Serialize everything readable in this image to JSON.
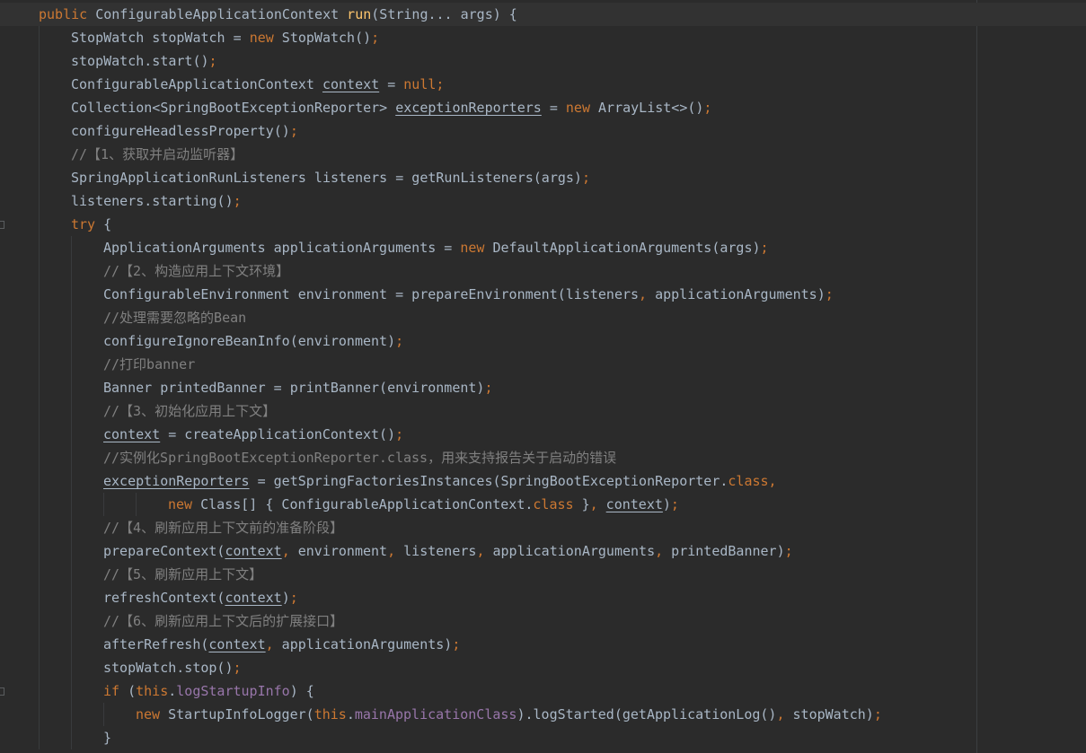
{
  "editor": {
    "language": "Java",
    "colors": {
      "background": "#2b2b2b",
      "keyword": "#cc7832",
      "method_declaration": "#ffc66d",
      "comment": "#808080",
      "field": "#9876aa",
      "plain": "#a9b7c6",
      "current_line": "#323232"
    },
    "lines": [
      {
        "indent": 0,
        "current": true,
        "tokens": [
          {
            "t": "public",
            "c": "kw"
          },
          {
            "t": " ConfigurableApplicationContext ",
            "c": "pl"
          },
          {
            "t": "run",
            "c": "fn"
          },
          {
            "t": "(String... args) {",
            "c": "pl"
          }
        ]
      },
      {
        "indent": 1,
        "tokens": [
          {
            "t": "StopWatch stopWatch = ",
            "c": "pl"
          },
          {
            "t": "new",
            "c": "kw"
          },
          {
            "t": " StopWatch()",
            "c": "pl"
          },
          {
            "t": ";",
            "c": "kw"
          }
        ]
      },
      {
        "indent": 1,
        "tokens": [
          {
            "t": "stopWatch.start()",
            "c": "pl"
          },
          {
            "t": ";",
            "c": "kw"
          }
        ]
      },
      {
        "indent": 1,
        "tokens": [
          {
            "t": "ConfigurableApplicationContext ",
            "c": "pl"
          },
          {
            "t": "context",
            "c": "pl",
            "u": true
          },
          {
            "t": " = ",
            "c": "pl"
          },
          {
            "t": "null;",
            "c": "kw"
          }
        ]
      },
      {
        "indent": 1,
        "tokens": [
          {
            "t": "Collection<SpringBootExceptionReporter> ",
            "c": "pl"
          },
          {
            "t": "exceptionReporters",
            "c": "pl",
            "u": true
          },
          {
            "t": " = ",
            "c": "pl"
          },
          {
            "t": "new",
            "c": "kw"
          },
          {
            "t": " ArrayList<>()",
            "c": "pl"
          },
          {
            "t": ";",
            "c": "kw"
          }
        ]
      },
      {
        "indent": 1,
        "tokens": [
          {
            "t": "configureHeadlessProperty()",
            "c": "pl"
          },
          {
            "t": ";",
            "c": "kw"
          }
        ]
      },
      {
        "indent": 1,
        "tokens": [
          {
            "t": "//【1、获取并启动监听器】",
            "c": "cm"
          }
        ]
      },
      {
        "indent": 1,
        "tokens": [
          {
            "t": "SpringApplicationRunListeners listeners = getRunListeners(args)",
            "c": "pl"
          },
          {
            "t": ";",
            "c": "kw"
          }
        ]
      },
      {
        "indent": 1,
        "tokens": [
          {
            "t": "listeners.starting()",
            "c": "pl"
          },
          {
            "t": ";",
            "c": "kw"
          }
        ]
      },
      {
        "indent": 1,
        "tokens": [
          {
            "t": "try",
            "c": "kw"
          },
          {
            "t": " {",
            "c": "pl"
          }
        ]
      },
      {
        "indent": 2,
        "tokens": [
          {
            "t": "ApplicationArguments applicationArguments = ",
            "c": "pl"
          },
          {
            "t": "new",
            "c": "kw"
          },
          {
            "t": " DefaultApplicationArguments(args)",
            "c": "pl"
          },
          {
            "t": ";",
            "c": "kw"
          }
        ]
      },
      {
        "indent": 2,
        "tokens": [
          {
            "t": "//【2、构造应用上下文环境】",
            "c": "cm"
          }
        ]
      },
      {
        "indent": 2,
        "tokens": [
          {
            "t": "ConfigurableEnvironment environment = prepareEnvironment(listeners",
            "c": "pl"
          },
          {
            "t": ",",
            "c": "kw"
          },
          {
            "t": " applicationArguments)",
            "c": "pl"
          },
          {
            "t": ";",
            "c": "kw"
          }
        ]
      },
      {
        "indent": 2,
        "tokens": [
          {
            "t": "//处理需要忽略的Bean",
            "c": "cm"
          }
        ]
      },
      {
        "indent": 2,
        "tokens": [
          {
            "t": "configureIgnoreBeanInfo(environment)",
            "c": "pl"
          },
          {
            "t": ";",
            "c": "kw"
          }
        ]
      },
      {
        "indent": 2,
        "tokens": [
          {
            "t": "//打印banner",
            "c": "cm"
          }
        ]
      },
      {
        "indent": 2,
        "tokens": [
          {
            "t": "Banner printedBanner = printBanner(environment)",
            "c": "pl"
          },
          {
            "t": ";",
            "c": "kw"
          }
        ]
      },
      {
        "indent": 2,
        "tokens": [
          {
            "t": "//【3、初始化应用上下文】",
            "c": "cm"
          }
        ]
      },
      {
        "indent": 2,
        "tokens": [
          {
            "t": "context",
            "c": "pl",
            "u": true
          },
          {
            "t": " = createApplicationContext()",
            "c": "pl"
          },
          {
            "t": ";",
            "c": "kw"
          }
        ]
      },
      {
        "indent": 2,
        "tokens": [
          {
            "t": "//实例化SpringBootExceptionReporter.class，用来支持报告关于启动的错误",
            "c": "cm"
          }
        ]
      },
      {
        "indent": 2,
        "tokens": [
          {
            "t": "exceptionReporters",
            "c": "pl",
            "u": true
          },
          {
            "t": " = getSpringFactoriesInstances(SpringBootExceptionReporter.",
            "c": "pl"
          },
          {
            "t": "class,",
            "c": "kw"
          }
        ]
      },
      {
        "indent": 4,
        "tokens": [
          {
            "t": "new",
            "c": "kw"
          },
          {
            "t": " Class[] { ConfigurableApplicationContext.",
            "c": "pl"
          },
          {
            "t": "class",
            "c": "kw"
          },
          {
            "t": " }",
            "c": "pl"
          },
          {
            "t": ",",
            "c": "kw"
          },
          {
            "t": " ",
            "c": "pl"
          },
          {
            "t": "context",
            "c": "pl",
            "u": true
          },
          {
            "t": ")",
            "c": "pl"
          },
          {
            "t": ";",
            "c": "kw"
          }
        ]
      },
      {
        "indent": 2,
        "tokens": [
          {
            "t": "//【4、刷新应用上下文前的准备阶段】",
            "c": "cm"
          }
        ]
      },
      {
        "indent": 2,
        "tokens": [
          {
            "t": "prepareContext(",
            "c": "pl"
          },
          {
            "t": "context",
            "c": "pl",
            "u": true
          },
          {
            "t": ",",
            "c": "kw"
          },
          {
            "t": " environment",
            "c": "pl"
          },
          {
            "t": ",",
            "c": "kw"
          },
          {
            "t": " listeners",
            "c": "pl"
          },
          {
            "t": ",",
            "c": "kw"
          },
          {
            "t": " applicationArguments",
            "c": "pl"
          },
          {
            "t": ",",
            "c": "kw"
          },
          {
            "t": " printedBanner)",
            "c": "pl"
          },
          {
            "t": ";",
            "c": "kw"
          }
        ]
      },
      {
        "indent": 2,
        "tokens": [
          {
            "t": "//【5、刷新应用上下文】",
            "c": "cm"
          }
        ]
      },
      {
        "indent": 2,
        "tokens": [
          {
            "t": "refreshContext(",
            "c": "pl"
          },
          {
            "t": "context",
            "c": "pl",
            "u": true
          },
          {
            "t": ")",
            "c": "pl"
          },
          {
            "t": ";",
            "c": "kw"
          }
        ]
      },
      {
        "indent": 2,
        "tokens": [
          {
            "t": "//【6、刷新应用上下文后的扩展接口】",
            "c": "cm"
          }
        ]
      },
      {
        "indent": 2,
        "tokens": [
          {
            "t": "afterRefresh(",
            "c": "pl"
          },
          {
            "t": "context",
            "c": "pl",
            "u": true
          },
          {
            "t": ",",
            "c": "kw"
          },
          {
            "t": " applicationArguments)",
            "c": "pl"
          },
          {
            "t": ";",
            "c": "kw"
          }
        ]
      },
      {
        "indent": 2,
        "tokens": [
          {
            "t": "stopWatch.stop()",
            "c": "pl"
          },
          {
            "t": ";",
            "c": "kw"
          }
        ]
      },
      {
        "indent": 2,
        "tokens": [
          {
            "t": "if",
            "c": "kw"
          },
          {
            "t": " (",
            "c": "pl"
          },
          {
            "t": "this",
            "c": "kw"
          },
          {
            "t": ".",
            "c": "pl"
          },
          {
            "t": "logStartupInfo",
            "c": "fld"
          },
          {
            "t": ") {",
            "c": "pl"
          }
        ]
      },
      {
        "indent": 3,
        "tokens": [
          {
            "t": "new",
            "c": "kw"
          },
          {
            "t": " StartupInfoLogger(",
            "c": "pl"
          },
          {
            "t": "this",
            "c": "kw"
          },
          {
            "t": ".",
            "c": "pl"
          },
          {
            "t": "mainApplicationClass",
            "c": "fld"
          },
          {
            "t": ").logStarted(getApplicationLog()",
            "c": "pl"
          },
          {
            "t": ",",
            "c": "kw"
          },
          {
            "t": " stopWatch)",
            "c": "pl"
          },
          {
            "t": ";",
            "c": "kw"
          }
        ]
      },
      {
        "indent": 2,
        "tokens": [
          {
            "t": "}",
            "c": "pl"
          }
        ]
      }
    ]
  }
}
